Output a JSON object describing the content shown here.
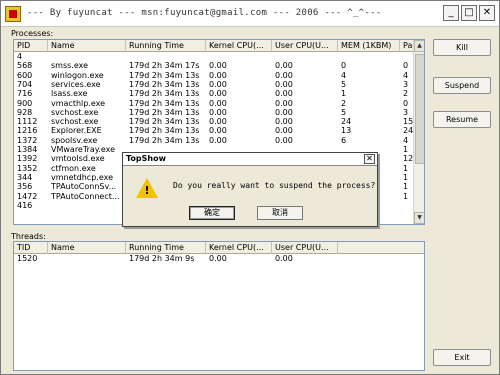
{
  "window": {
    "title": "--- By fuyuncat --- msn:fuyuncat@gmail.com --- 2006 --- ^_^---",
    "minimize": "_",
    "maximize": "□",
    "close": "✕"
  },
  "processes": {
    "label": "Processes:",
    "columns": [
      "PID",
      "Name",
      "Running Time",
      "Kernel CPU(...",
      "User CPU(U...",
      "MEM (1KBM)",
      "Pa"
    ],
    "rows": [
      [
        "4",
        "",
        "",
        "",
        "",
        "",
        ""
      ],
      [
        "568",
        "smss.exe",
        "179d 2h 34m 17s",
        "0.00",
        "0.00",
        "0",
        "0"
      ],
      [
        "600",
        "winlogon.exe",
        "179d 2h 34m 13s",
        "0.00",
        "0.00",
        "4",
        "4"
      ],
      [
        "704",
        "services.exe",
        "179d 2h 34m 13s",
        "0.00",
        "0.00",
        "5",
        "3"
      ],
      [
        "716",
        "lsass.exe",
        "179d 2h 34m 13s",
        "0.00",
        "0.00",
        "1",
        "2"
      ],
      [
        "900",
        "vmacthlp.exe",
        "179d 2h 34m 13s",
        "0.00",
        "0.00",
        "2",
        "0"
      ],
      [
        "928",
        "svchost.exe",
        "179d 2h 34m 13s",
        "0.00",
        "0.00",
        "5",
        "3"
      ],
      [
        "1112",
        "svchost.exe",
        "179d 2h 34m 13s",
        "0.00",
        "0.00",
        "24",
        "15"
      ],
      [
        "1216",
        "Explorer.EXE",
        "179d 2h 34m 13s",
        "0.00",
        "0.00",
        "13",
        "24"
      ],
      [
        "1372",
        "spoolsv.exe",
        "179d 2h 34m 13s",
        "0.00",
        "0.00",
        "6",
        "4"
      ],
      [
        "1384",
        "VMwareTray.exe",
        "",
        "",
        "",
        "",
        "1"
      ],
      [
        "1392",
        "vmtoolsd.exe",
        "",
        "",
        "",
        "",
        "12"
      ],
      [
        "1352",
        "ctfmon.exe",
        "",
        "",
        "",
        "",
        "1"
      ],
      [
        "344",
        "vmnetdhcp.exe",
        "",
        "",
        "",
        "",
        "1"
      ],
      [
        "356",
        "TPAutoConnSv...",
        "",
        "",
        "",
        "",
        "1"
      ],
      [
        "1472",
        "TPAutoConnect...",
        "",
        "",
        "",
        "",
        "1"
      ],
      [
        "416",
        "",
        "",
        "",
        "",
        "",
        ""
      ]
    ]
  },
  "threads": {
    "label": "Threads:",
    "columns": [
      "TID",
      "Name",
      "Running Time",
      "Kernel CPU(...",
      "User CPU(U..."
    ],
    "rows": [
      [
        "1520",
        "",
        "179d 2h 34m 9s",
        "0.00",
        "0.00"
      ]
    ]
  },
  "buttons": {
    "kill": "Kill",
    "suspend": "Suspend",
    "resume": "Resume",
    "exit": "Exit"
  },
  "dialog": {
    "title": "TopShow",
    "message": "Do you really want to suspend the process?",
    "confirm": "确定",
    "cancel": "取消"
  }
}
